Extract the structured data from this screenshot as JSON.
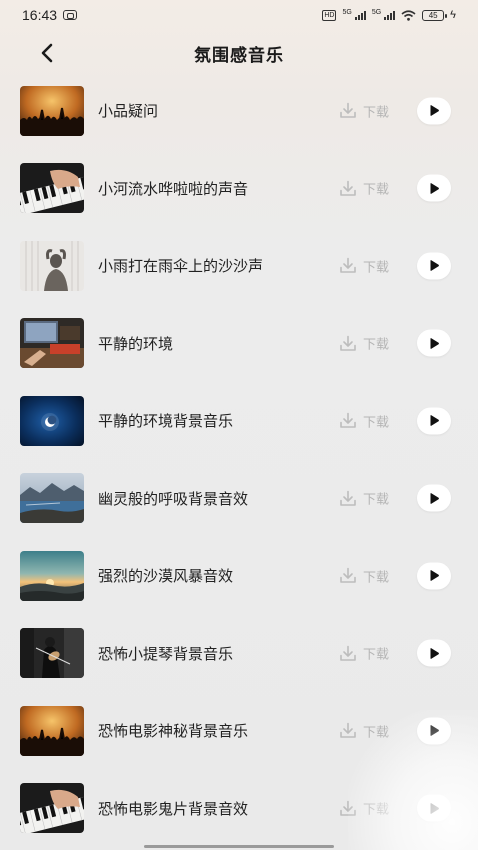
{
  "status_bar": {
    "time": "16:43",
    "network_1": "5G",
    "network_2": "5G",
    "hd_label": "HD",
    "battery": "45"
  },
  "header": {
    "title": "氛围感音乐"
  },
  "download_label": "下载",
  "songs": [
    {
      "title": "小品疑问",
      "thumb": "concert-crowd"
    },
    {
      "title": "小河流水哗啦啦的声音",
      "thumb": "piano-hands"
    },
    {
      "title": "小雨打在雨伞上的沙沙声",
      "thumb": "rain-figure"
    },
    {
      "title": "平静的环境",
      "thumb": "studio-desk"
    },
    {
      "title": "平静的环境背景音乐",
      "thumb": "night-moon"
    },
    {
      "title": "幽灵般的呼吸背景音效",
      "thumb": "lake-mountains"
    },
    {
      "title": "强烈的沙漠风暴音效",
      "thumb": "sunset-hills"
    },
    {
      "title": "恐怖小提琴背景音乐",
      "thumb": "violin-player"
    },
    {
      "title": "恐怖电影神秘背景音乐",
      "thumb": "concert-crowd"
    },
    {
      "title": "恐怖电影鬼片背景音效",
      "thumb": "piano-hands"
    }
  ]
}
